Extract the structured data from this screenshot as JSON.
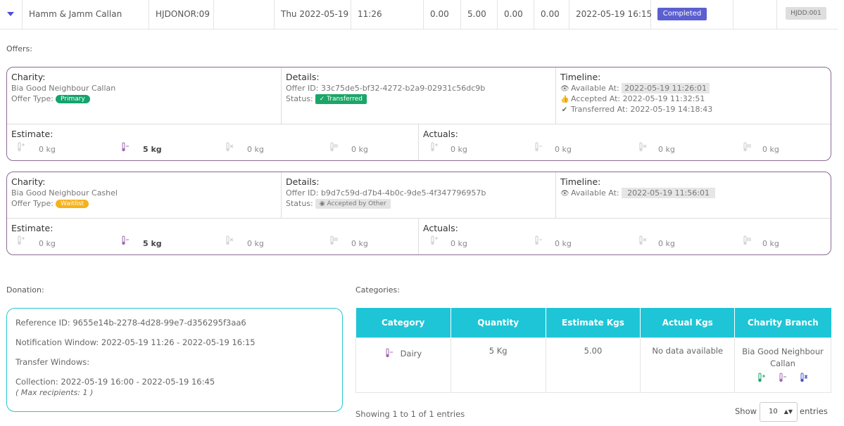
{
  "row": {
    "name": "Hamm & Jamm Callan",
    "donor_code": "HJDONOR:09",
    "date": "Thu 2022-05-19",
    "time": "11:26",
    "v1": "0.00",
    "v2": "5.00",
    "v3": "0.00",
    "v4": "0.00",
    "end": "2022-05-19 16:15",
    "status": "Completed",
    "code": "HJDD:001"
  },
  "offers_label": "Offers:",
  "offers": [
    {
      "charity_head": "Charity:",
      "charity_name": "Bia Good Neighbour Callan",
      "offer_type_label": "Offer Type:",
      "offer_type": "Primary",
      "details_head": "Details:",
      "offer_id": "Offer ID: 33c75de5-bf32-4272-b2a9-02931c56dc9b",
      "status_label": "Status:",
      "status": "Transferred",
      "timeline_head": "Timeline:",
      "available_label": "Available At:",
      "available": "2022-05-19 11:26:01",
      "accepted_label": "Accepted At:",
      "accepted": "2022-05-19 11:32:51",
      "transferred_label": "Transferred At:",
      "transferred": "2022-05-19 14:18:43",
      "estimate_head": "Estimate:",
      "actuals_head": "Actuals:",
      "estimate": [
        "0 kg",
        "5 kg",
        "0 kg",
        "0 kg"
      ],
      "actuals": [
        "0 kg",
        "0 kg",
        "0 kg",
        "0 kg"
      ]
    },
    {
      "charity_head": "Charity:",
      "charity_name": "Bia Good Neighbour Cashel",
      "offer_type_label": "Offer Type:",
      "offer_type": "Waitlist",
      "details_head": "Details:",
      "offer_id": "Offer ID: b9d7c59d-d7b4-4b0c-9de5-4f347796957b",
      "status_label": "Status:",
      "status": "Accepted by Other",
      "timeline_head": "Timeline:",
      "available_label": "Available At:",
      "available": "2022-05-19 11:56:01",
      "estimate_head": "Estimate:",
      "actuals_head": "Actuals:",
      "estimate": [
        "0 kg",
        "5 kg",
        "0 kg",
        "0 kg"
      ],
      "actuals": [
        "0 kg",
        "0 kg",
        "0 kg",
        "0 kg"
      ]
    }
  ],
  "donation": {
    "label": "Donation:",
    "reference": "Reference ID: 9655e14b-2278-4d28-99e7-d356295f3aa6",
    "notification": "Notification Window: 2022-05-19 11:26 - 2022-05-19 16:15",
    "transfer": "Transfer Windows:",
    "collection": "Collection: 2022-05-19 16:00 - 2022-05-19 16:45",
    "max_recipients": "( Max recipients: 1 )"
  },
  "categories": {
    "label": "Categories:",
    "headers": [
      "Category",
      "Quantity",
      "Estimate Kgs",
      "Actual Kgs",
      "Charity Branch"
    ],
    "row": {
      "category": "Dairy",
      "quantity": "5 Kg",
      "estimate": "5.00",
      "actual": "No data available",
      "branch": "Bia Good Neighbour Callan"
    },
    "showing": "Showing 1 to 1 of 1 entries",
    "show_label": "Show",
    "page_size": "10",
    "entries_label": "entries"
  },
  "colors": {
    "accent_purple": "#5b5fd0",
    "teal": "#1ec5d6",
    "green": "#15a36e",
    "orange": "#f6b21b",
    "card_border": "#8b6b94"
  },
  "icons": [
    "chevron-down-icon",
    "eye-icon",
    "thumbs-up-icon",
    "check-icon",
    "thermometer-plus-icon",
    "thermometer-minus-icon",
    "thermometer-snow-icon",
    "thermometer-ambient-icon"
  ]
}
